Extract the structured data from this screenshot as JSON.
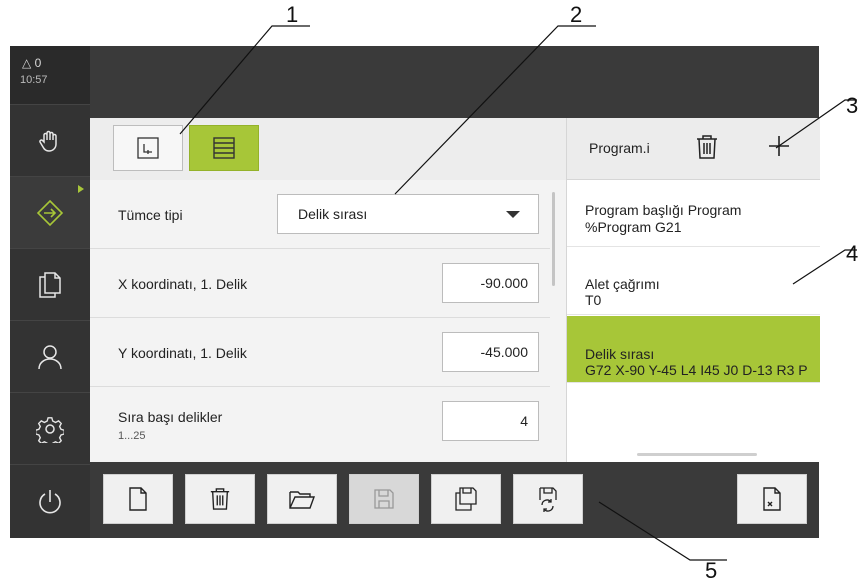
{
  "callouts": [
    "1",
    "2",
    "3",
    "4",
    "5"
  ],
  "status": {
    "warnings": "△ 0",
    "time": "10:57"
  },
  "sidebar": {
    "items": [
      {
        "icon": "hand-icon"
      },
      {
        "icon": "arrow-right-circle-icon",
        "active": true
      },
      {
        "icon": "documents-icon"
      },
      {
        "icon": "user-icon"
      },
      {
        "icon": "gear-icon"
      },
      {
        "icon": "power-icon"
      }
    ]
  },
  "form": {
    "rows": [
      {
        "label": "Tümce tipi",
        "value": "Delik sırası"
      },
      {
        "label": "X koordinatı, 1. Delik",
        "value": "-90.000"
      },
      {
        "label": "Y koordinatı, 1. Delik",
        "value": "-45.000"
      },
      {
        "label": "Sıra başı delikler",
        "sublabel": "1...25",
        "value": "4"
      }
    ]
  },
  "program": {
    "title": "Program.i",
    "blocks": [
      {
        "line1": "Program başlığı Program",
        "line2": "%Program G21"
      },
      {
        "line1": "Alet çağrımı",
        "line2": "T0"
      },
      {
        "line1": "Delik sırası",
        "line2": "G72 X-90 Y-45 L4 I45 J0 D-13 R3 P",
        "selected": true
      }
    ]
  },
  "toolbar": {
    "buttons": [
      "new-file-icon",
      "trash-icon",
      "folder-open-icon",
      "save-icon",
      "save-as-icon",
      "save-refresh-icon",
      "close-file-icon"
    ]
  },
  "colors": {
    "accent": "#a7c638",
    "sidebar": "#333333",
    "bar": "#3a3a3a"
  }
}
